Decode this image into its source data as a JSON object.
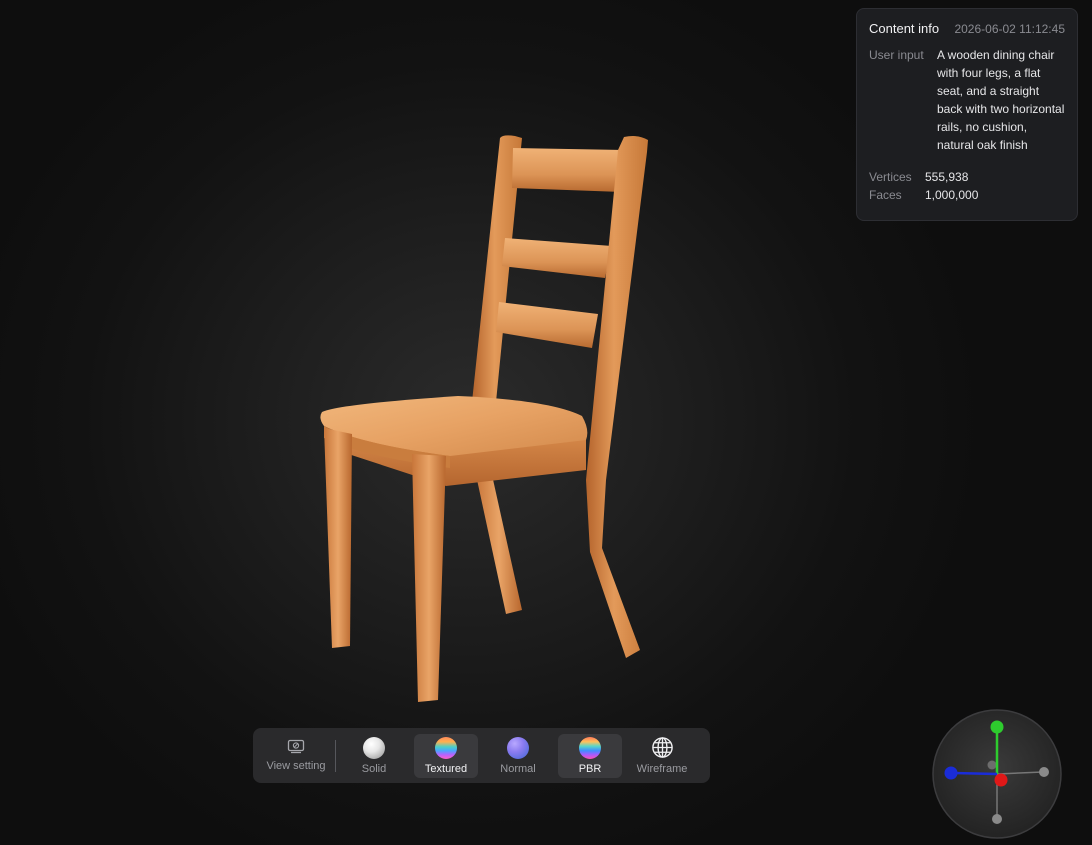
{
  "content_info": {
    "title": "Content info",
    "timestamp": "2026-06-02 11:12:45",
    "user_input_label": "User input",
    "user_input_text": "A wooden dining chair with four legs, a flat seat, and a straight back with two horizontal rails, no cushion, natural oak finish",
    "vertices_label": "Vertices",
    "vertices_value": "555,938",
    "faces_label": "Faces",
    "faces_value": "1,000,000"
  },
  "toolbar": {
    "view_setting_label": "View setting",
    "modes": [
      {
        "label": "Solid",
        "icon": "solid-sphere-icon",
        "active": false
      },
      {
        "label": "Textured",
        "icon": "textured-sphere-icon",
        "active": true
      },
      {
        "label": "Normal",
        "icon": "normal-sphere-icon",
        "active": false
      },
      {
        "label": "PBR",
        "icon": "pbr-sphere-icon",
        "active": true
      },
      {
        "label": "Wireframe",
        "icon": "wireframe-globe-icon",
        "active": false
      }
    ]
  },
  "axis_gizmo": {
    "colors": {
      "x": "#e01818",
      "y": "#2ecc2e",
      "z": "#1a2cd8",
      "negative": "#8a8a8a"
    }
  },
  "colors": {
    "background": "#141414",
    "panel": "#1d1e21",
    "toolbar": "#2a2a2c",
    "wood_light": "#e8a566",
    "wood_dark": "#b8672e"
  }
}
